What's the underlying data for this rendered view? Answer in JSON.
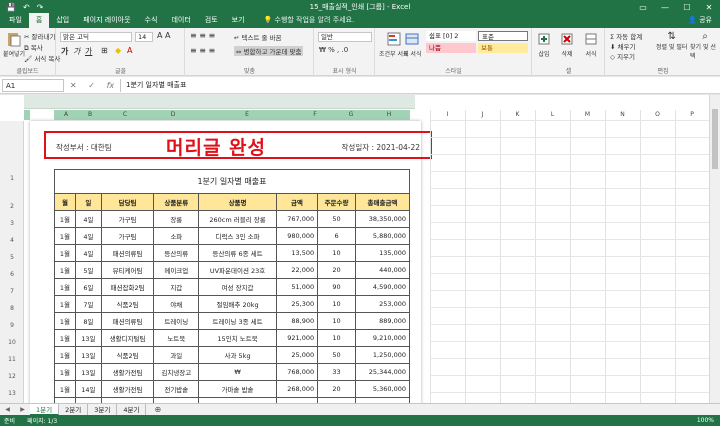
{
  "window": {
    "title": "15_매출실적_인쇄 [그룹] - Excel"
  },
  "tabs": [
    "파일",
    "홈",
    "삽입",
    "페이지 레이아웃",
    "수식",
    "데이터",
    "검토",
    "보기"
  ],
  "tell_me": "수행할 작업을 알려 주세요.",
  "share": "공유",
  "ribbon": {
    "clipboard": {
      "paste": "붙여넣기",
      "cut": "잘라내기",
      "copy": "복사",
      "format": "서식 복사",
      "label": "클립보드"
    },
    "font": {
      "name": "맑은 고딕",
      "size": "14",
      "label": "글꼴"
    },
    "align": {
      "wrap": "텍스트 줄 바꿈",
      "merge": "병합하고 가운데 맞춤",
      "label": "맞춤"
    },
    "number": {
      "format": "일반",
      "label": "표시 형식"
    },
    "styles": {
      "conditional": "조건부 서식",
      "table": "표 서식",
      "s1": "쉼표 [0] 2",
      "s2": "표준",
      "s3": "나쁨",
      "s4": "보통",
      "label": "스타일"
    },
    "cells": {
      "insert": "삽입",
      "delete": "삭제",
      "format": "서식",
      "label": "셀"
    },
    "edit": {
      "autosum": "자동 합계",
      "fill": "채우기",
      "clear": "지우기",
      "sort": "정렬 및 필터",
      "find": "찾기 및 선택",
      "label": "편집"
    }
  },
  "formula_bar": {
    "name_box": "A1",
    "formula": "1분기 일자별 매출표"
  },
  "columns_left": [
    "A",
    "B",
    "C",
    "D",
    "E",
    "F",
    "G",
    "H"
  ],
  "columns_right": [
    "I",
    "J",
    "K",
    "L",
    "M",
    "N",
    "O",
    "P"
  ],
  "row_numbers": [
    "1",
    "2",
    "3",
    "4",
    "5",
    "6",
    "7",
    "8",
    "9",
    "10",
    "11",
    "12",
    "13",
    "14",
    "15",
    "16"
  ],
  "page_header": {
    "left": "작성부서 : 대한팀",
    "center": "머리글 완성",
    "right": "작성일자 : 2021-04-22"
  },
  "table": {
    "title": "1분기 일자별 매출표",
    "headers": [
      "월",
      "일",
      "담당팀",
      "상품분류",
      "상품명",
      "금액",
      "주문수량",
      "총매출금액"
    ],
    "rows": [
      [
        "1월",
        "4일",
        "가구팀",
        "장롱",
        "260cm 러블리 장롱",
        "767,000",
        "50",
        "38,350,000"
      ],
      [
        "1월",
        "4일",
        "가구팀",
        "소파",
        "디럭스 3인 소파",
        "980,000",
        "6",
        "5,880,000"
      ],
      [
        "1월",
        "4일",
        "패션의류팀",
        "등산의류",
        "등산의류 6종 세트",
        "13,500",
        "10",
        "135,000"
      ],
      [
        "1월",
        "5일",
        "뷰티케어팀",
        "메이크업",
        "UV파운데이션 23호",
        "22,000",
        "20",
        "440,000"
      ],
      [
        "1월",
        "6일",
        "패션잡화2팀",
        "지갑",
        "여성 장지갑",
        "51,000",
        "90",
        "4,590,000"
      ],
      [
        "1월",
        "7일",
        "식품2팀",
        "야채",
        "절임배추 20kg",
        "25,300",
        "10",
        "253,000"
      ],
      [
        "1월",
        "8일",
        "패션의류팀",
        "트레이닝",
        "트레이닝 3종 세트",
        "88,900",
        "10",
        "889,000"
      ],
      [
        "1월",
        "13일",
        "생활디지털팀",
        "노트북",
        "15인치 노트북",
        "921,000",
        "10",
        "9,210,000"
      ],
      [
        "1월",
        "13일",
        "식품2팀",
        "과일",
        "사과 5kg",
        "25,000",
        "50",
        "1,250,000"
      ],
      [
        "1월",
        "13일",
        "생활가전팀",
        "김치냉장고",
        "₩",
        "768,000",
        "33",
        "25,344,000"
      ],
      [
        "1월",
        "14일",
        "생활가전팀",
        "전기밥솥",
        "가마솥 밥솥",
        "268,000",
        "20",
        "5,360,000"
      ],
      [
        "1월",
        "14일",
        "가구팀",
        "침대",
        "싱글 스탠드 침대",
        "489,000",
        "20",
        "9,780,000"
      ],
      [
        "1월",
        "15일",
        "가구팀",
        "침대",
        "퀸 돌침대",
        "879,000",
        "30",
        "26,370,000"
      ]
    ]
  },
  "sheet_tabs": [
    "1분기",
    "2분기",
    "3분기",
    "4분기"
  ],
  "status": {
    "ready": "준비",
    "page": "페이지: 1/3",
    "zoom": "100%"
  }
}
